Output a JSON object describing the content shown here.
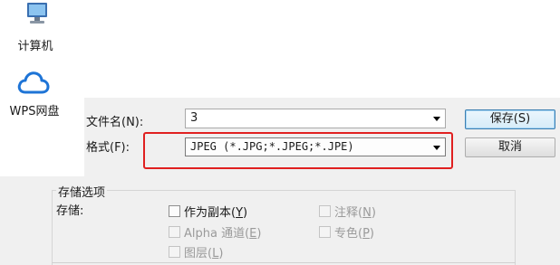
{
  "nav": {
    "items": [
      {
        "label": "计算机",
        "icon": "computer-icon"
      },
      {
        "label": "WPS网盘",
        "icon": "cloud-icon"
      }
    ]
  },
  "form": {
    "filename_label": "文件名(N):",
    "filename_value": "3",
    "format_label": "格式(F):",
    "format_value": "JPEG (*.JPG;*.JPEG;*.JPE)"
  },
  "buttons": {
    "save": "保存(S)",
    "cancel": "取消"
  },
  "storage": {
    "group_title": "存储选项",
    "storage_label": "存储:",
    "options": {
      "copy": {
        "text": "作为副本(",
        "key": "Y",
        "tail": ")",
        "enabled": true,
        "checked": false
      },
      "alpha": {
        "text": "Alpha 通道(",
        "key": "E",
        "tail": ")",
        "enabled": false,
        "checked": false
      },
      "layers": {
        "text": "图层(",
        "key": "L",
        "tail": ")",
        "enabled": false,
        "checked": false
      },
      "notes": {
        "text": "注释(",
        "key": "N",
        "tail": ")",
        "enabled": false,
        "checked": false
      },
      "spot": {
        "text": "专色(",
        "key": "P",
        "tail": ")",
        "enabled": false,
        "checked": false
      }
    }
  },
  "colors": {
    "highlight": "#e02020",
    "cloud_icon": "#1e74d6",
    "background": "#f0f0f0"
  }
}
